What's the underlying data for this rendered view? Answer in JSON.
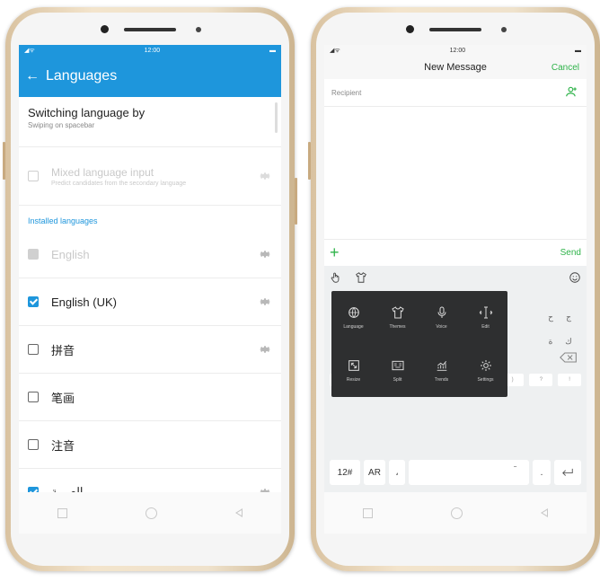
{
  "left_phone": {
    "status_time": "12:00",
    "appbar": {
      "back_icon": "arrow-left-icon",
      "title": "Languages"
    },
    "switch_row": {
      "title": "Switching language by",
      "subtitle": "Swiping on spacebar"
    },
    "mixed_row": {
      "title": "Mixed language input",
      "subtitle": "Predict candidates from the secondary language",
      "enabled": false
    },
    "section_header": "Installed languages",
    "languages": [
      {
        "label": "English",
        "checked": true,
        "disabled": true,
        "has_settings": true
      },
      {
        "label": "English (UK)",
        "checked": true,
        "disabled": false,
        "has_settings": true
      },
      {
        "label": "拼音",
        "checked": false,
        "disabled": false,
        "has_settings": true
      },
      {
        "label": "笔画",
        "checked": false,
        "disabled": false,
        "has_settings": false
      },
      {
        "label": "注音",
        "checked": false,
        "disabled": false,
        "has_settings": false
      },
      {
        "label": "العربية",
        "checked": true,
        "disabled": false,
        "has_settings": true
      }
    ]
  },
  "right_phone": {
    "status_time": "12:00",
    "header": {
      "title": "New Message",
      "cancel": "Cancel"
    },
    "recipient_placeholder": "Recipient",
    "compose": {
      "plus": "+",
      "send": "Send"
    },
    "toolbox": [
      {
        "label": "Language",
        "icon": "globe-icon"
      },
      {
        "label": "Themes",
        "icon": "tshirt-icon"
      },
      {
        "label": "Voice",
        "icon": "microphone-icon"
      },
      {
        "label": "Edit",
        "icon": "cursor-edit-icon"
      },
      {
        "label": "Resize",
        "icon": "resize-icon"
      },
      {
        "label": "Split",
        "icon": "split-keyboard-icon"
      },
      {
        "label": "Trends",
        "icon": "trends-icon"
      },
      {
        "label": "Settings",
        "icon": "gear-icon"
      }
    ],
    "keyboard": {
      "arabic_keys": [
        "ح",
        "ج",
        "ة",
        "ك"
      ],
      "row3": [
        "@",
        "#",
        "_",
        "-",
        "'",
        "(",
        ")",
        "?",
        "!"
      ],
      "bottom": {
        "numsym": "12#",
        "lang": "AR",
        "comma": "،",
        "mic_hint": "ـ",
        "dot": "."
      }
    }
  }
}
